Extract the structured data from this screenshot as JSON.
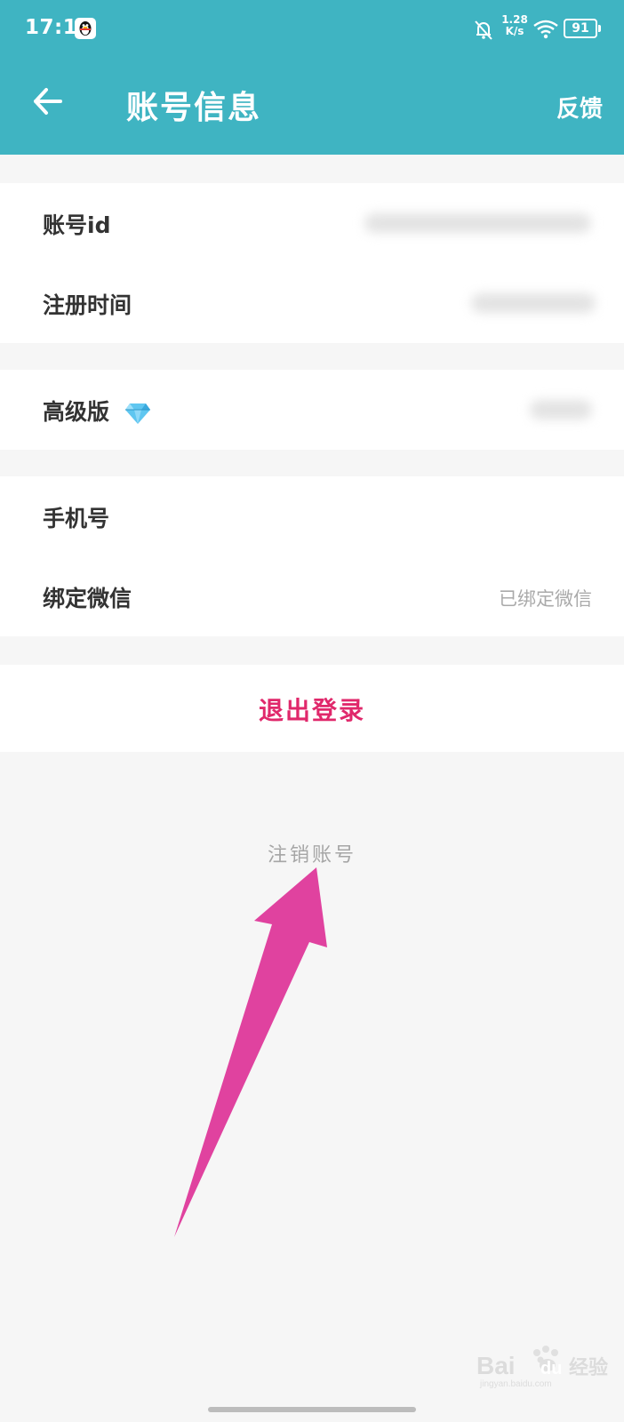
{
  "status_bar": {
    "time": "17:16",
    "net_speed_value": "1.28",
    "net_speed_unit": "K/s",
    "battery": "91",
    "icons": [
      "qq-icon",
      "bell-off-icon",
      "wifi-icon",
      "battery-icon"
    ]
  },
  "header": {
    "title": "账号信息",
    "feedback": "反馈",
    "background_color": "#3fb4c2"
  },
  "account": {
    "account_id_label": "账号id",
    "register_time_label": "注册时间",
    "premium_label": "高级版",
    "premium_icon": "diamond-icon",
    "phone_label": "手机号",
    "wechat_label": "绑定微信",
    "wechat_value": "已绑定微信"
  },
  "actions": {
    "logout": "退出登录",
    "logout_color": "#e0286b",
    "cancel_account": "注销账号"
  },
  "annotation": {
    "arrow_color": "#e0429f"
  },
  "watermark": {
    "brand": "Bai",
    "brand2": "du",
    "product": "经验",
    "site": "jingyan.baidu.com"
  }
}
